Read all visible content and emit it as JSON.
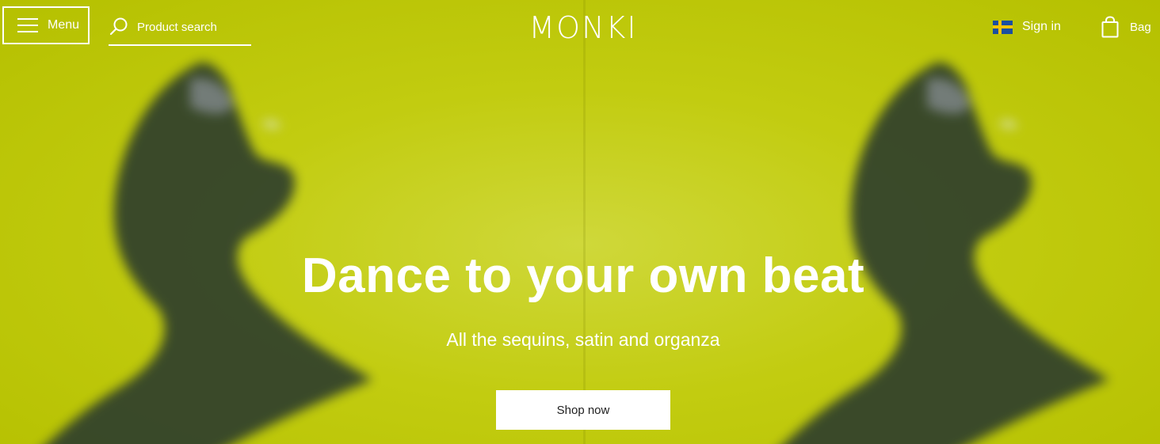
{
  "header": {
    "menu_label": "Menu",
    "search_placeholder": "Product search",
    "logo_text": "MONKI",
    "signin_label": "Sign in",
    "bag_label": "Bag"
  },
  "hero": {
    "headline": "Dance to your own beat",
    "subheadline": "All the sequins, satin and organza",
    "cta_label": "Shop now"
  },
  "colors": {
    "hero_background": "#bec900",
    "text": "#ffffff",
    "button_background": "#ffffff",
    "button_text": "#222222"
  },
  "icons": [
    "hamburger-icon",
    "search-icon",
    "sweden-flag-icon",
    "shopping-bag-icon"
  ]
}
